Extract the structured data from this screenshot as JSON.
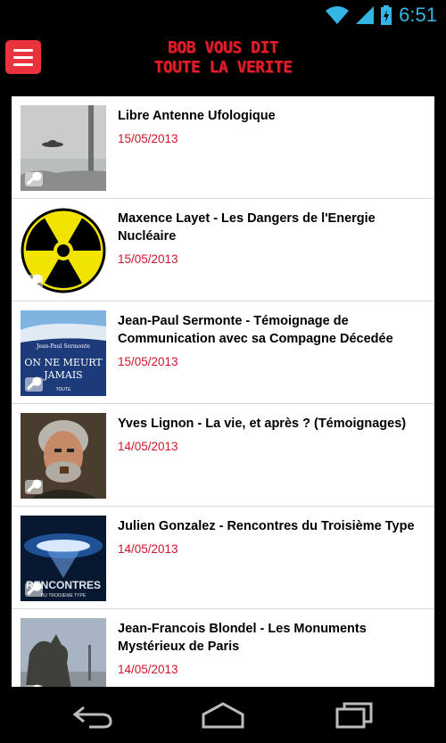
{
  "status_bar": {
    "time": "6:51"
  },
  "header": {
    "title_line1": "BOB VOUS DIT",
    "title_line2": "TOUTE LA VERITE"
  },
  "colors": {
    "accent": "#e8323e",
    "date": "#d0152a",
    "status_blue": "#33b5e5"
  },
  "items": [
    {
      "title": "Libre Antenne Ufologique",
      "date": "15/05/2013",
      "thumb": "ufo-photo"
    },
    {
      "title": "Maxence Layet - Les Dangers de l'Energie Nucléaire",
      "date": "15/05/2013",
      "thumb": "radiation-symbol"
    },
    {
      "title": "Jean-Paul Sermonte - Témoignage de Communication avec sa Compagne Décedée",
      "date": "15/05/2013",
      "thumb": "book-cover",
      "thumb_text_top": "Jean-Paul Sermonte",
      "thumb_text_mid": "ON NE MEURT",
      "thumb_text_bottom": "JAMAIS",
      "thumb_text_pub": "TOUTE"
    },
    {
      "title": "Yves Lignon - La vie, et après ? (Témoignages)",
      "date": "14/05/2013",
      "thumb": "portrait"
    },
    {
      "title": "Julien Gonzalez - Rencontres du Troisième Type",
      "date": "14/05/2013",
      "thumb": "movie-poster",
      "thumb_text_main": "RENCONTRES",
      "thumb_text_sub": "DU TROISIEME TYPE"
    },
    {
      "title": "Jean-Francois Blondel - Les Monuments Mystérieux de Paris",
      "date": "14/05/2013",
      "thumb": "gargoyle-photo"
    }
  ]
}
